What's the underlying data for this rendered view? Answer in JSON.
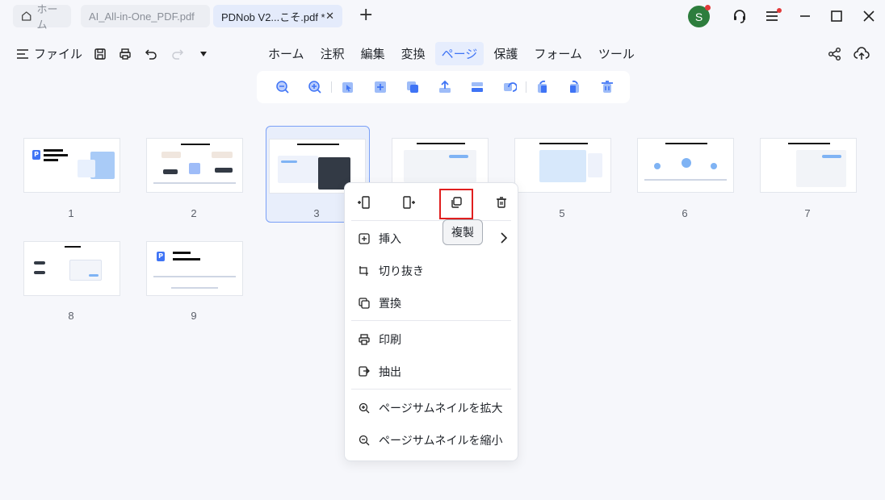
{
  "titlebar": {
    "home_tab": "ホーム",
    "tabs": [
      {
        "label": "AI_All-in-One_PDF.pdf"
      },
      {
        "label": "PDNob V2...こそ.pdf *",
        "close": "✕"
      }
    ],
    "new_tab": "+",
    "avatar_letter": "S"
  },
  "menubar": {
    "file_label": "ファイル",
    "items": [
      "ホーム",
      "注釈",
      "編集",
      "変換",
      "ページ",
      "保護",
      "フォーム",
      "ツール"
    ],
    "active": "ページ"
  },
  "pages": [
    {
      "number": "1"
    },
    {
      "number": "2"
    },
    {
      "number": "3"
    },
    {
      "number": "5"
    },
    {
      "number": "6"
    },
    {
      "number": "7"
    },
    {
      "number": "8"
    },
    {
      "number": "9"
    }
  ],
  "context_menu": {
    "tooltip": "複製",
    "items": [
      {
        "label": "挿入",
        "icon": "insert-icon",
        "has_submenu": true
      },
      {
        "label": "切り抜き",
        "icon": "crop-icon"
      },
      {
        "label": "置換",
        "icon": "replace-icon"
      },
      {
        "label": "印刷",
        "icon": "print-icon"
      },
      {
        "label": "抽出",
        "icon": "extract-icon"
      },
      {
        "label": "ページサムネイルを拡大",
        "icon": "zoom-in-icon"
      },
      {
        "label": "ページサムネイルを縮小",
        "icon": "zoom-out-icon"
      }
    ]
  },
  "colors": {
    "accent": "#3f74f5",
    "highlight_red": "#e01f1f",
    "background": "#f6f7fb"
  }
}
